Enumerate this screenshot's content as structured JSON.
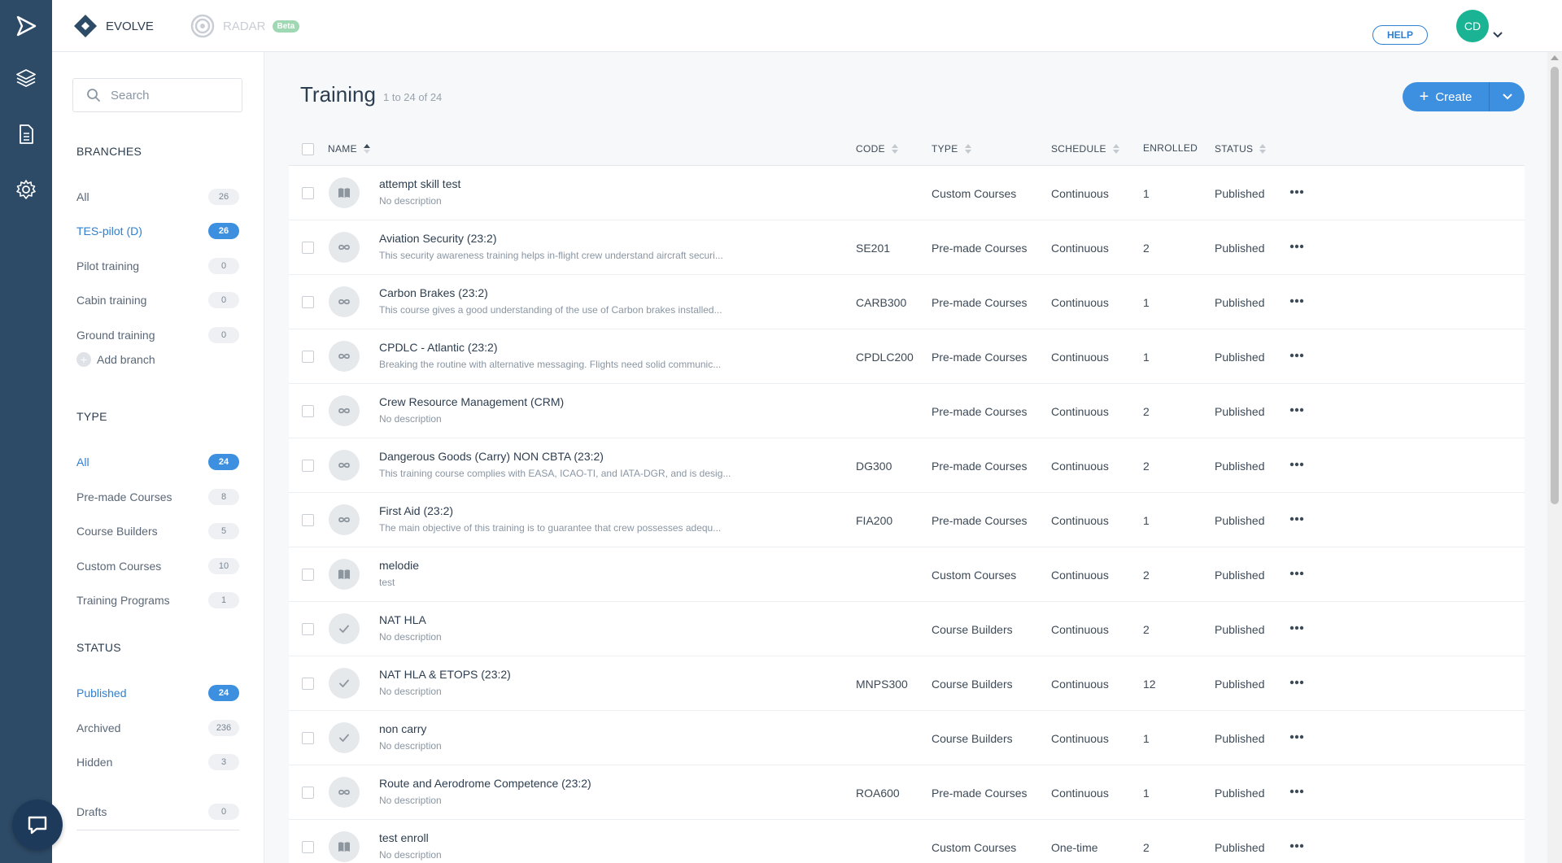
{
  "topbar": {
    "evolve_label": "EVOLVE",
    "radar_label": "RADAR",
    "beta_label": "Beta",
    "help_label": "HELP",
    "avatar_initials": "CD"
  },
  "rail": {
    "icons": [
      "paper-plane-icon",
      "layers-icon",
      "document-icon",
      "gear-icon"
    ]
  },
  "filters": {
    "search_placeholder": "Search",
    "branches_title": "BRANCHES",
    "branches": [
      {
        "label": "All",
        "count": "26"
      },
      {
        "label": "TES-pilot (D)",
        "count": "26"
      },
      {
        "label": "Pilot training",
        "count": "0"
      },
      {
        "label": "Cabin training",
        "count": "0"
      },
      {
        "label": "Ground training",
        "count": "0"
      }
    ],
    "add_branch_label": "Add branch",
    "type_title": "TYPE",
    "types": [
      {
        "label": "All",
        "count": "24"
      },
      {
        "label": "Pre-made Courses",
        "count": "8"
      },
      {
        "label": "Course Builders",
        "count": "5"
      },
      {
        "label": "Custom Courses",
        "count": "10"
      },
      {
        "label": "Training Programs",
        "count": "1"
      }
    ],
    "status_title": "STATUS",
    "statuses": [
      {
        "label": "Published",
        "count": "24"
      },
      {
        "label": "Archived",
        "count": "236"
      },
      {
        "label": "Hidden",
        "count": "3"
      }
    ],
    "drafts": {
      "label": "Drafts",
      "count": "0"
    }
  },
  "main": {
    "title": "Training",
    "subtitle": "1 to 24 of 24",
    "create_label": "Create",
    "columns": {
      "name": "NAME",
      "code": "CODE",
      "type": "TYPE",
      "schedule": "SCHEDULE",
      "enrolled": "ENROLLED",
      "status": "STATUS"
    },
    "rows": [
      {
        "icon": "book-icon",
        "name": "attempt skill test",
        "desc": "No description",
        "code": "",
        "type": "Custom Courses",
        "schedule": "Continuous",
        "enrolled": "1",
        "status": "Published"
      },
      {
        "icon": "infinity-icon",
        "name": "Aviation Security (23:2)",
        "desc": "This security awareness training helps in-flight crew understand aircraft securi...",
        "code": "SE201",
        "type": "Pre-made Courses",
        "schedule": "Continuous",
        "enrolled": "2",
        "status": "Published"
      },
      {
        "icon": "infinity-icon",
        "name": "Carbon Brakes (23:2)",
        "desc": "This course gives a good understanding of the use of Carbon brakes installed...",
        "code": "CARB300",
        "type": "Pre-made Courses",
        "schedule": "Continuous",
        "enrolled": "1",
        "status": "Published"
      },
      {
        "icon": "infinity-icon",
        "name": "CPDLC - Atlantic (23:2)",
        "desc": "Breaking the routine with alternative messaging. Flights need solid communic...",
        "code": "CPDLC200",
        "type": "Pre-made Courses",
        "schedule": "Continuous",
        "enrolled": "1",
        "status": "Published"
      },
      {
        "icon": "infinity-icon",
        "name": "Crew Resource Management (CRM)",
        "desc": "No description",
        "code": "",
        "type": "Pre-made Courses",
        "schedule": "Continuous",
        "enrolled": "2",
        "status": "Published"
      },
      {
        "icon": "infinity-icon",
        "name": "Dangerous Goods (Carry) NON CBTA (23:2)",
        "desc": "This training course complies with EASA, ICAO-TI, and IATA-DGR, and is desig...",
        "code": "DG300",
        "type": "Pre-made Courses",
        "schedule": "Continuous",
        "enrolled": "2",
        "status": "Published"
      },
      {
        "icon": "infinity-icon",
        "name": "First Aid (23:2)",
        "desc": "The main objective of this training is to guarantee that crew possesses adequ...",
        "code": "FIA200",
        "type": "Pre-made Courses",
        "schedule": "Continuous",
        "enrolled": "1",
        "status": "Published"
      },
      {
        "icon": "book-icon",
        "name": "melodie",
        "desc": "test",
        "code": "",
        "type": "Custom Courses",
        "schedule": "Continuous",
        "enrolled": "2",
        "status": "Published"
      },
      {
        "icon": "check-icon",
        "name": "NAT HLA",
        "desc": "No description",
        "code": "",
        "type": "Course Builders",
        "schedule": "Continuous",
        "enrolled": "2",
        "status": "Published"
      },
      {
        "icon": "check-icon",
        "name": "NAT HLA & ETOPS (23:2)",
        "desc": "No description",
        "code": "MNPS300",
        "type": "Course Builders",
        "schedule": "Continuous",
        "enrolled": "12",
        "status": "Published"
      },
      {
        "icon": "check-icon",
        "name": "non carry",
        "desc": "No description",
        "code": "",
        "type": "Course Builders",
        "schedule": "Continuous",
        "enrolled": "1",
        "status": "Published"
      },
      {
        "icon": "infinity-icon",
        "name": "Route and Aerodrome Competence (23:2)",
        "desc": "No description",
        "code": "ROA600",
        "type": "Pre-made Courses",
        "schedule": "Continuous",
        "enrolled": "1",
        "status": "Published"
      },
      {
        "icon": "book-icon",
        "name": "test enroll",
        "desc": "No description",
        "code": "",
        "type": "Custom Courses",
        "schedule": "One-time",
        "enrolled": "2",
        "status": "Published"
      }
    ]
  },
  "colors": {
    "rail": "#2d4a66",
    "accent": "#3d8fe0",
    "avatar": "#1ab394"
  }
}
